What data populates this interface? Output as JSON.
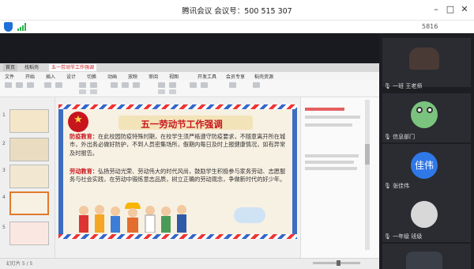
{
  "window": {
    "title": "腾讯会议 会议号：500 515 307",
    "code_short": "5816"
  },
  "wps": {
    "tabs": [
      "首页",
      "找稻壳",
      "五一劳动节工作强调"
    ],
    "menu": [
      "文件",
      "开始",
      "插入",
      "设计",
      "切换",
      "动画",
      "放映",
      "审阅",
      "视图",
      "开发工具",
      "会员专享",
      "稻壳资源"
    ],
    "status": "幻灯片 5 / 5"
  },
  "slide": {
    "title": "五一劳动节工作强调",
    "para1_label": "防疫教育：",
    "para1_text": "在此校园防疫特殊时期，在校学生须严格遵守防疫要求，不随意离开所在城市，外出务必做好防护，不到人员密集场所，假期内每日及时上报健康情况，如有异常及时报告。",
    "para2_label": "劳动教育：",
    "para2_text": "弘扬劳动光荣、劳动伟大的时代风尚，鼓励学生积极参与家务劳动、志愿服务与社会实践，在劳动中锻炼意志品质，树立正确的劳动观念，争做新时代的好少年。"
  },
  "participants": [
    {
      "name": "一班 王老师",
      "avatar": "photo"
    },
    {
      "name": "信息部门",
      "avatar": "frog"
    },
    {
      "name": "张佳伟",
      "avatar": "text",
      "avatar_text": "佳伟"
    },
    {
      "name": "一年级 班级",
      "avatar": "gray"
    },
    {
      "name": "",
      "avatar": "photo"
    }
  ]
}
